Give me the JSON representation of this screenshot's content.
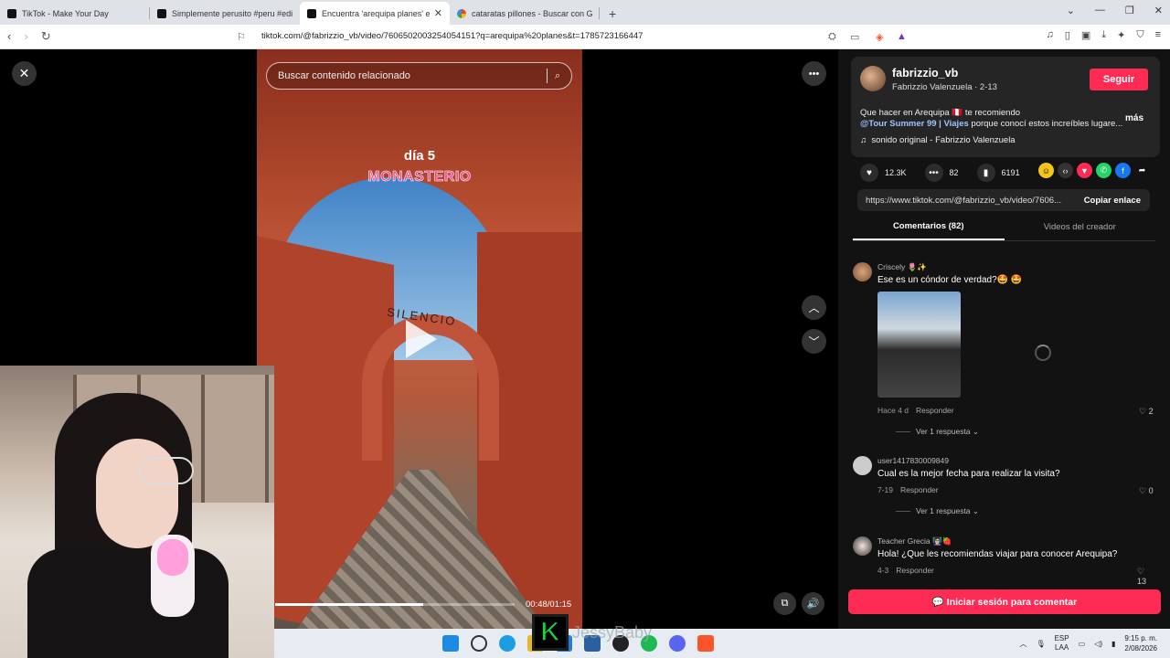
{
  "browser": {
    "tabs": [
      {
        "title": "TikTok - Make Your Day",
        "active": false
      },
      {
        "title": "Simplemente perusito #peru #edit #",
        "active": false
      },
      {
        "title": "Encuentra 'arequipa planes' en T",
        "active": true
      },
      {
        "title": "cataratas pillones - Buscar con Goog",
        "active": false
      }
    ],
    "new_tab": "+",
    "url": "tiktok.com/@fabrizzio_vb/video/7606502003254054151?q=arequipa%20planes&t=1785723166447"
  },
  "video": {
    "search_placeholder": "Buscar contenido relacionado",
    "overlay_line1": "día 5",
    "overlay_line2": "MONASTERIO",
    "sign_text": "SILENCIO",
    "progress_fraction": 0.62,
    "time": "00:48/01:15"
  },
  "author": {
    "username": "fabrizzio_vb",
    "subtitle": "Fabrizzio Valenzuela · 2-13",
    "follow_label": "Seguir",
    "desc_line1": "Que hacer en Arequipa 🇵🇪 te recomiendo",
    "desc_tags": "@Tour Summer 99 | Viajes",
    "desc_rest": " porque conocí estos increíbles lugare...",
    "more_label": "más",
    "sound": "sonido original - Fabrizzio Valenzuela"
  },
  "stats": {
    "likes": "12.3K",
    "comments": "82",
    "saves": "6191"
  },
  "share": {
    "link": "https://www.tiktok.com/@fabrizzio_vb/video/7606...",
    "copy_label": "Copiar enlace"
  },
  "tabs": {
    "comments": "Comentarios (82)",
    "creator_videos": "Videos del creador"
  },
  "comments": [
    {
      "user": "Criscely 🌷✨",
      "text": "Ese es un cóndor de verdad?🤩 🤩",
      "date": "Hace 4 d",
      "reply_label": "Responder",
      "likes": "2",
      "replies": "Ver 1 respuesta"
    },
    {
      "user": "user1417830009849",
      "text": "Cual es la mejor fecha para realizar la visita?",
      "date": "7-19",
      "reply_label": "Responder",
      "likes": "0",
      "replies": "Ver 1 respuesta"
    },
    {
      "user": "Teacher Grecia 👩🏻‍🏫🍓",
      "text": "Hola! ¿Que les recomiendas viajar para conocer Arequipa?",
      "date": "4-3",
      "reply_label": "Responder",
      "likes": "13"
    }
  ],
  "login_label": "Iniciar sesión para comentar",
  "stream": {
    "badge": "K",
    "name": "JessyBaby"
  },
  "taskbar": {
    "lang1": "ESP",
    "lang2": "LAA",
    "time": "9:15 p. m.",
    "date": "2/08/2026"
  },
  "colors": {
    "accent": "#fe2c55",
    "panel_bg": "#121212",
    "tag": "#9ec5ff"
  }
}
